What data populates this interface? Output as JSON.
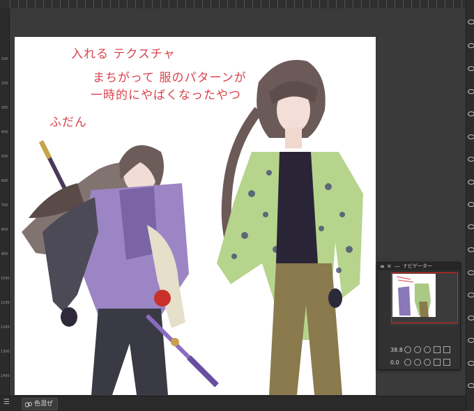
{
  "canvas_notes": {
    "line1": "入れる テクスチャ",
    "line2": "まちがって 服のパターンが",
    "line3": "一時的にやばくなったやつ",
    "line4": "ふだん"
  },
  "ruler_numbers": [
    "1400",
    "1300",
    "1200",
    "1100",
    "1000",
    "900",
    "800",
    "700",
    "600",
    "500",
    "400",
    "300",
    "200",
    "100"
  ],
  "navigator": {
    "title": "ナビゲーター",
    "menu_glyph": "≡",
    "close_glyph": "✕",
    "minimize_glyph": "—",
    "zoom_value": "38.8",
    "rotation_value": "0.0"
  },
  "status_bar": {
    "menu_glyph": "☰",
    "tab_label": "色混ぜ"
  },
  "colors": {
    "note_red": "#d9434c",
    "nav_frame": "#e02020",
    "ui_dark": "#3a3a3a"
  }
}
